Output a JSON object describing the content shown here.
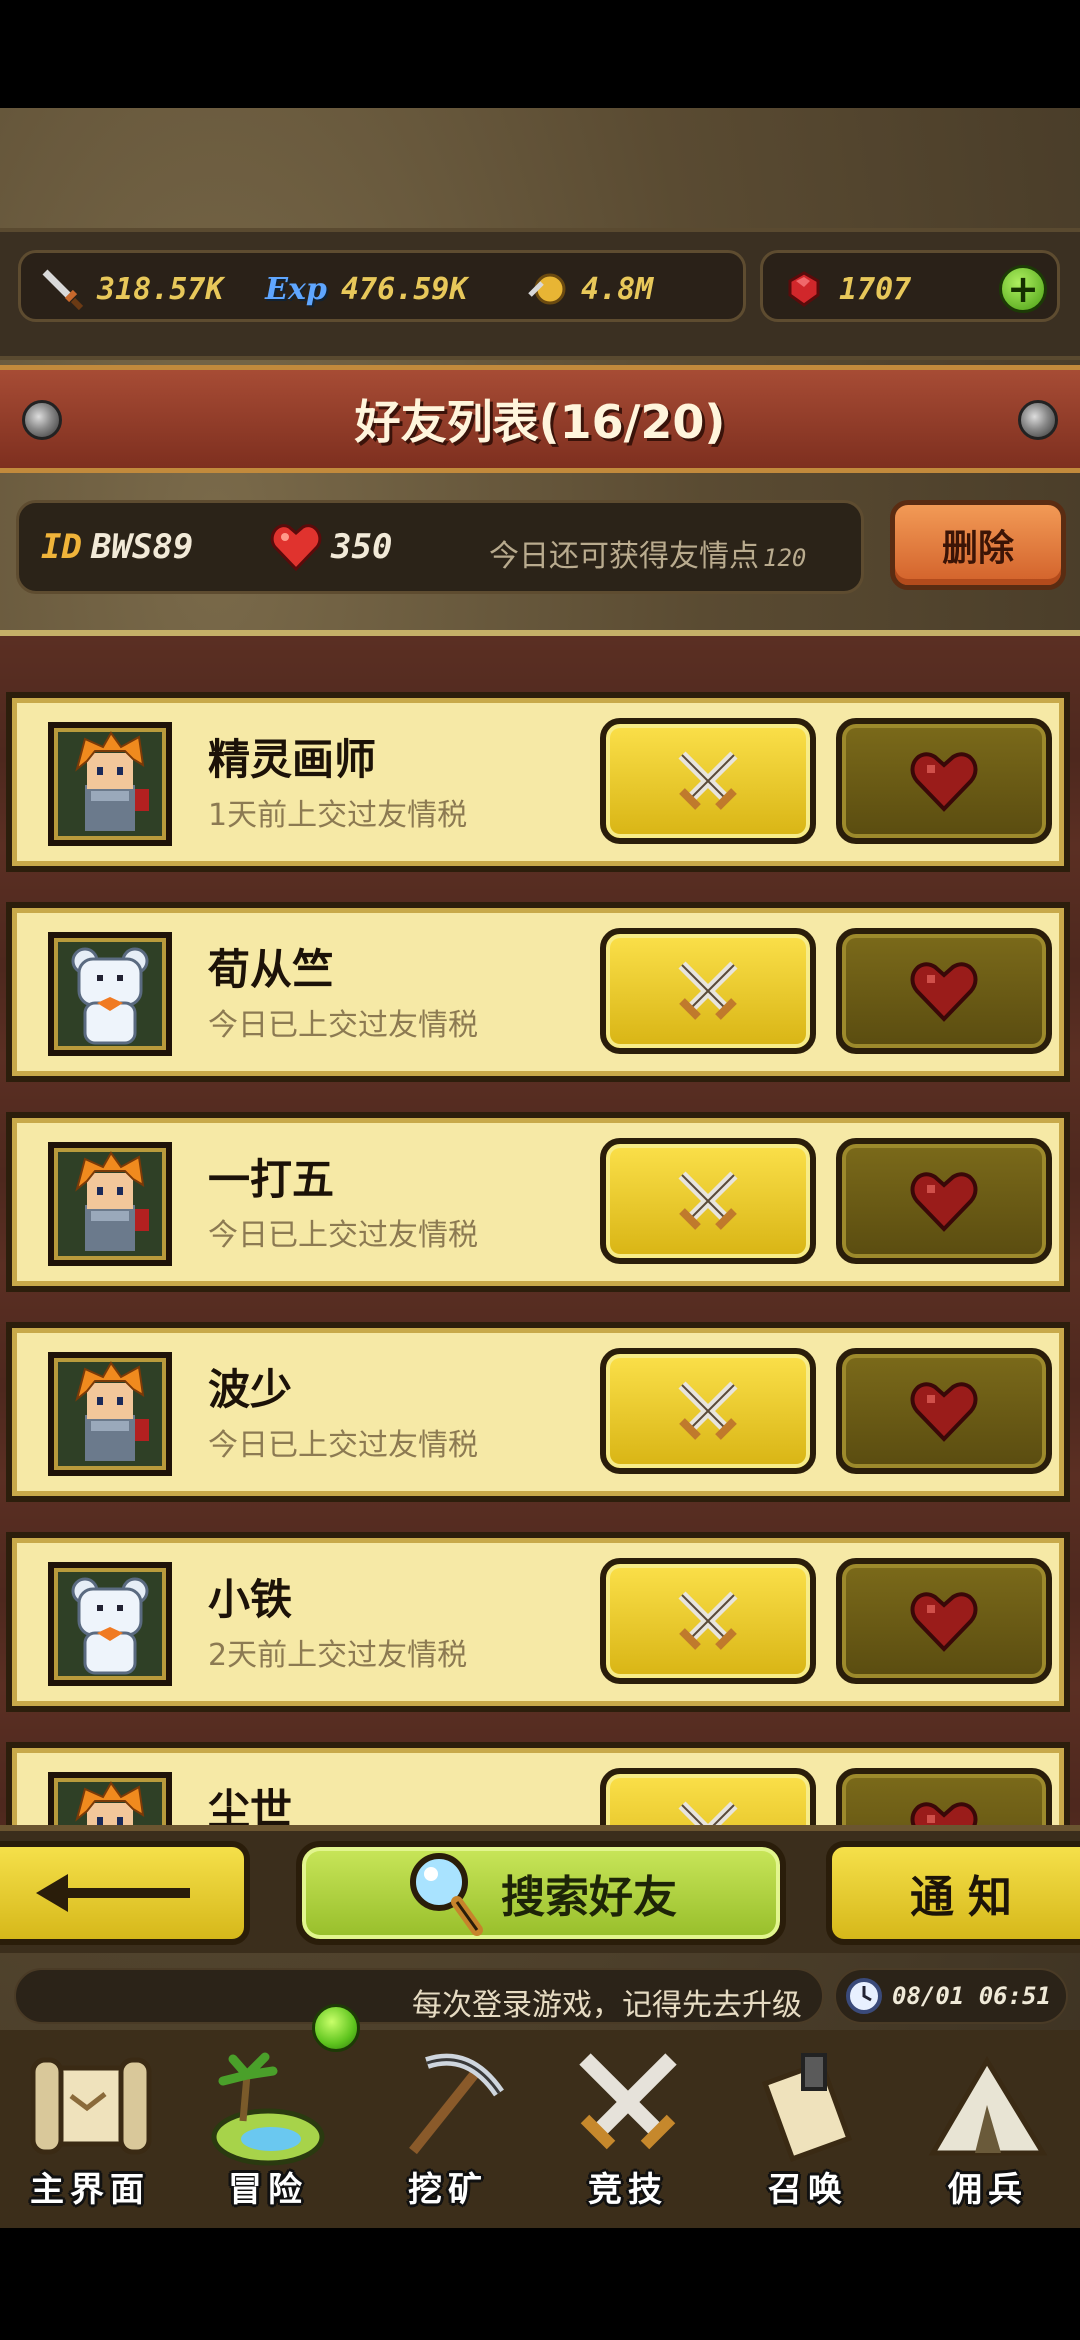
{
  "resources": {
    "attack": "318.57K",
    "exp": "476.59K",
    "gold": "4.8M",
    "gems": "1707",
    "exp_icon_label": "Exp"
  },
  "header": {
    "title": "好友列表(16/20)"
  },
  "info": {
    "id_label": "ID",
    "id_value": "BWS89",
    "hearts": "350",
    "today_text": "今日还可获得友情点",
    "today_points": "120",
    "delete_label": "删除"
  },
  "friends": [
    {
      "name": "精灵画师",
      "status": "1天前上交过友情税",
      "avatar": "orange-hair-knight"
    },
    {
      "name": "荀从竺",
      "status": "今日已上交过友情税",
      "avatar": "white-bear"
    },
    {
      "name": "一打五",
      "status": "今日已上交过友情税",
      "avatar": "orange-hair-knight"
    },
    {
      "name": "波少",
      "status": "今日已上交过友情税",
      "avatar": "orange-hair-knight"
    },
    {
      "name": "小铁",
      "status": "2天前上交过友情税",
      "avatar": "white-bear"
    },
    {
      "name": "尘世",
      "status": "",
      "avatar": "orange-hair-knight"
    }
  ],
  "actions": {
    "search_label": "搜索好友",
    "notify_label": "通知"
  },
  "tip": {
    "text": "每次登录游戏，记得先去升级",
    "clock": "08/01 06:51"
  },
  "nav": [
    {
      "label": "主界面",
      "icon": "scroll-map-icon"
    },
    {
      "label": "冒险",
      "icon": "island-icon"
    },
    {
      "label": "挖矿",
      "icon": "pickaxe-icon"
    },
    {
      "label": "竞技",
      "icon": "crossed-swords-icon"
    },
    {
      "label": "召唤",
      "icon": "summon-scroll-icon"
    },
    {
      "label": "佣兵",
      "icon": "tent-icon"
    }
  ],
  "colors": {
    "accent_yellow": "#f5e04a",
    "banner_red": "#a74c35",
    "row_bg": "#f6e9a6",
    "search_green": "#b4d844",
    "delete_orange": "#e57a3e"
  }
}
